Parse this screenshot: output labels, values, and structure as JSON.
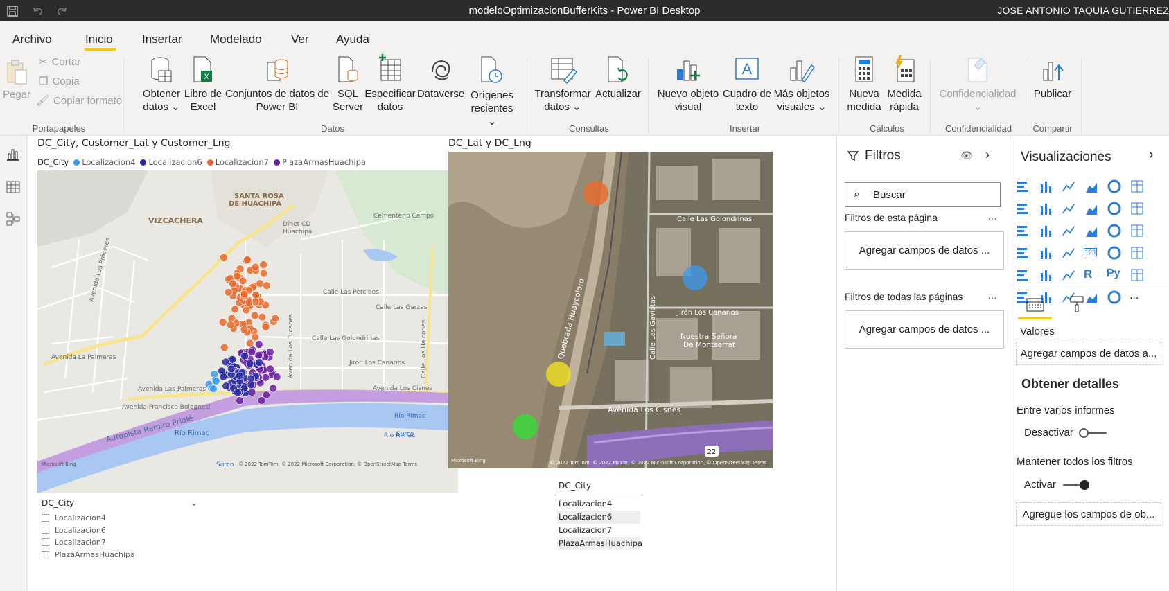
{
  "window": {
    "title": "modeloOptimizacionBufferKits - Power BI Desktop",
    "user": "JOSE ANTONIO TAQUIA GUTIERREZ"
  },
  "menu": {
    "tabs": [
      "Archivo",
      "Inicio",
      "Insertar",
      "Modelado",
      "Ver",
      "Ayuda"
    ],
    "active": "Inicio"
  },
  "ribbon": {
    "pegar": "Pegar",
    "cortar": "Cortar",
    "copia": "Copia",
    "copiar_formato": "Copiar formato",
    "portapapeles": "Portapapeles",
    "obtener_datos_1": "Obtener",
    "obtener_datos_2": "datos",
    "libro_excel_1": "Libro de",
    "libro_excel_2": "Excel",
    "conjuntos_1": "Conjuntos de datos de",
    "conjuntos_2": "Power BI",
    "sql_1": "SQL",
    "sql_2": "Server",
    "especificar_1": "Especificar",
    "especificar_2": "datos",
    "dataverse": "Dataverse",
    "origenes_1": "Orígenes",
    "origenes_2": "recientes",
    "datos_label": "Datos",
    "transformar_1": "Transformar",
    "transformar_2": "datos",
    "actualizar": "Actualizar",
    "consultas_label": "Consultas",
    "nuevo_objeto_1": "Nuevo objeto",
    "nuevo_objeto_2": "visual",
    "cuadro_texto_1": "Cuadro de",
    "cuadro_texto_2": "texto",
    "mas_objetos_1": "Más objetos",
    "mas_objetos_2": "visuales",
    "insertar_label": "Insertar",
    "nueva_medida_1": "Nueva",
    "nueva_medida_2": "medida",
    "medida_rapida_1": "Medida",
    "medida_rapida_2": "rápida",
    "calculos_label": "Cálculos",
    "confidencialidad": "Confidencialidad",
    "confidencialidad_label": "Confidencialidad",
    "publicar": "Publicar",
    "compartir_label": "Compartir"
  },
  "report": {
    "map1_title": "DC_City, Customer_Lat y Customer_Lng",
    "legend_title": "DC_City",
    "legend": [
      {
        "label": "Localizacion4",
        "color": "#3a99f0"
      },
      {
        "label": "Localizacion6",
        "color": "#2a2aa0"
      },
      {
        "label": "Localizacion7",
        "color": "#e86a2c"
      },
      {
        "label": "PlazaArmasHuachipa",
        "color": "#6a1ea0"
      }
    ],
    "map1_labels": {
      "vizcachera": "VIZCACHERA",
      "santa_rosa_1": "SANTA ROSA",
      "santa_rosa_2": "DE HUACHIPA",
      "dinet_1": "Dinet CD",
      "dinet_2": "Huachipa",
      "cementerio": "Cementerio Campo",
      "percides": "Calle Las Percides",
      "garzas": "Calle Las Garzas",
      "golondrinas": "Calle Las Golondrinas",
      "canarios": "Jirón Los Canarios",
      "cisnes": "Avenida Los Cisnes",
      "palmeras": "Avenida Las Palmeras",
      "palmeras2": "Avenida La Palmeras",
      "francisco": "Avenida Francisco Bolognesi",
      "autopista": "Autopista Ramiro Prialé",
      "rio_rimac_1": "Río Rímac",
      "rio_rimac_2": "Río Rimac",
      "rio_rimac_3": "Río Rimac",
      "surco_1": "Surco",
      "surco_2": "Surco",
      "tucanes": "Avenida Los Tucanes",
      "halcones": "Calle Los Halcones",
      "proceres": "Avenida Los Próceres",
      "copyright": "© 2022 TomTom, © 2022 Microsoft Corporation, © OpenStreetMap  Terms",
      "bing": "Microsoft Bing"
    },
    "map2_title": "DC_Lat y DC_Lng",
    "map2_labels": {
      "golondrinas": "Calle Las Golondrinas",
      "canarios": "Jirón Los Canarios",
      "nuestra_1": "Nuestra Señora",
      "nuestra_2": "De Montserrat",
      "cisnes": "Avenida Los Cisnes",
      "quebrada": "Quebrada Huaycoloro",
      "gaviotas": "Calle Las Gaviotas",
      "route": "22",
      "copyright": "© 2022 TomTom, © 2022 Maxar, © 2022 Microsoft Corporation, © OpenStreetMap  Terms",
      "bing": "Microsoft Bing"
    },
    "slicer": {
      "title": "DC_City",
      "items": [
        "Localizacion4",
        "Localizacion6",
        "Localizacion7",
        "PlazaArmasHuachipa"
      ]
    },
    "table": {
      "header": "DC_City",
      "rows": [
        "Localizacion4",
        "Localizacion6",
        "Localizacion7",
        "PlazaArmasHuachipa"
      ]
    }
  },
  "filters": {
    "title": "Filtros",
    "search_placeholder": "Buscar",
    "page_section": "Filtros de esta página",
    "all_section": "Filtros de todas las páginas",
    "add_fields": "Agregar campos de datos ...",
    "add_fields_2": "Agregar campos de datos ..."
  },
  "visualizations": {
    "title": "Visualizaciones",
    "valores": "Valores",
    "valores_well": "Agregar campos de datos a...",
    "obtener_detalles": "Obtener detalles",
    "entre_varios": "Entre varios informes",
    "desactivar": "Desactivar",
    "mantener": "Mantener todos los filtros",
    "activar": "Activar",
    "drill_well": "Agregue los campos de ob...",
    "grid_icons": [
      "stacked-bar",
      "stacked-column",
      "clustered-bar",
      "clustered-column",
      "100-bar",
      "100-column",
      "line",
      "area",
      "stacked-area",
      "line-column",
      "line-clustered",
      "ribbon",
      "waterfall",
      "funnel",
      "scatter",
      "pie",
      "donut",
      "treemap",
      "map",
      "filled-map",
      "gauge",
      "card",
      "multirow-card",
      "kpi",
      "slicer",
      "table",
      "matrix",
      "r-visual",
      "python-visual",
      "key-influencers",
      "qa",
      "smart-narrative",
      "paginated",
      "power-apps",
      "power-automate",
      "more"
    ],
    "r_glyph": "R",
    "py_glyph": "Py",
    "card_glyph": "123",
    "more_glyph": "..."
  }
}
